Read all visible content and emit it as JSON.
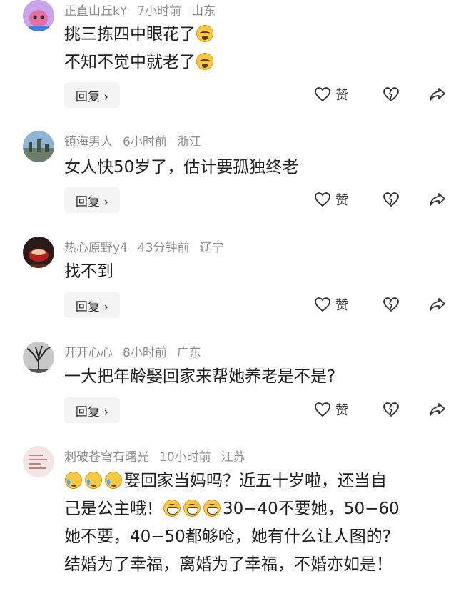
{
  "comments": [
    {
      "user": "正直山丘kY",
      "time": "7小时前",
      "location": "山东",
      "lines": [
        "挑三拣四中眼花了",
        "不知不觉中就老了"
      ],
      "reply_label": "回复 ›",
      "like_label": "赞"
    },
    {
      "user": "镇海男人",
      "time": "6小时前",
      "location": "浙江",
      "lines": [
        "女人快50岁了，估计要孤独终老"
      ],
      "reply_label": "回复 ›",
      "like_label": "赞"
    },
    {
      "user": "热心原野y4",
      "time": "43分钟前",
      "location": "辽宁",
      "lines": [
        "找不到"
      ],
      "reply_label": "回复 ›",
      "like_label": "赞"
    },
    {
      "user": "开开心心",
      "time": "8小时前",
      "location": "广东",
      "lines": [
        "一大把年龄娶回家来帮她养老是不是?"
      ],
      "reply_label": "回复 ›",
      "like_label": "赞"
    },
    {
      "user": "刺破苍穹有曙光",
      "time": "10小时前",
      "location": "江苏",
      "lines": [
        "娶回家当妈吗？近五十岁啦，还当自",
        "己是公主哦！",
        "30−40不要她，50−60",
        "她不要，40−50都够呛，她有什么让人图的?",
        "结婚为了幸福，离婚为了幸福，不婚亦如是！"
      ]
    }
  ],
  "icons": {
    "like": "heart-outline-icon",
    "dislike": "broken-heart-icon",
    "share": "share-arrow-icon",
    "emoji_cry": "crying-face-emoji",
    "emoji_tear": "tears-of-joy-emoji",
    "emoji_grin": "grinning-face-emoji"
  },
  "colors": {
    "meta_text": "#8e8e8e",
    "body_text": "#1f1f1f",
    "reply_bg": "#f4f4f4"
  }
}
